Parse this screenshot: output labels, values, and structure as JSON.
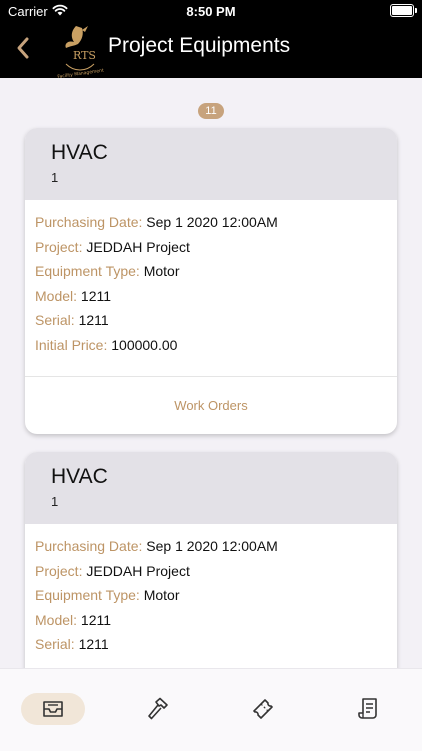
{
  "status": {
    "carrier": "Carrier",
    "time": "8:50 PM"
  },
  "nav": {
    "title": "Project Equipments",
    "back_icon": "chevron-left-icon",
    "logo_text": "RTS",
    "logo_caption": "Facility Management"
  },
  "list": {
    "count": "11",
    "cards": [
      {
        "name": "HVAC",
        "sub": "1",
        "fields": [
          {
            "label": "Purchasing Date:",
            "value": "Sep  1 2020 12:00AM"
          },
          {
            "label": "Project:",
            "value": "JEDDAH Project"
          },
          {
            "label": "Equipment Type:",
            "value": "Motor"
          },
          {
            "label": "Model:",
            "value": "1211"
          },
          {
            "label": "Serial:",
            "value": "1211"
          },
          {
            "label": "Initial Price:",
            "value": "100000.00"
          }
        ],
        "action": "Work Orders"
      },
      {
        "name": "HVAC",
        "sub": "1",
        "fields": [
          {
            "label": "Purchasing Date:",
            "value": "Sep  1 2020 12:00AM"
          },
          {
            "label": "Project:",
            "value": "JEDDAH Project"
          },
          {
            "label": "Equipment Type:",
            "value": "Motor"
          },
          {
            "label": "Model:",
            "value": "1211"
          },
          {
            "label": "Serial:",
            "value": "1211"
          }
        ]
      }
    ]
  },
  "tabs": [
    {
      "icon": "inbox-icon",
      "active": true
    },
    {
      "icon": "hammer-icon",
      "active": false
    },
    {
      "icon": "ticket-icon",
      "active": false
    },
    {
      "icon": "document-scroll-icon",
      "active": false
    }
  ],
  "colors": {
    "accent": "#bd9465",
    "badge": "#c7a37d",
    "header_gray": "#e3e1e7",
    "background": "#f3f1f6"
  }
}
